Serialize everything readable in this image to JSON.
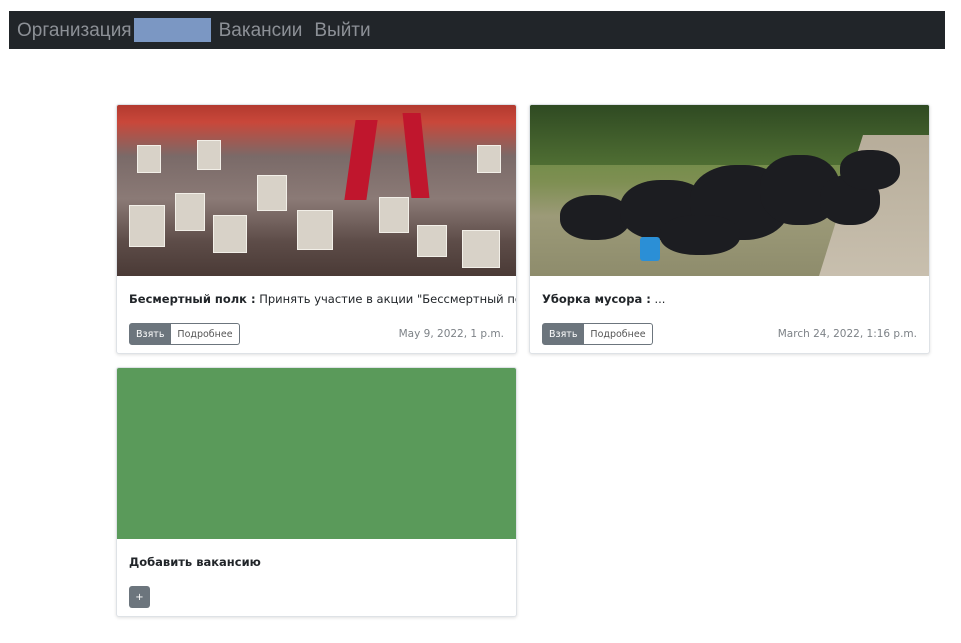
{
  "nav": {
    "brand": "Организация",
    "links": [
      "Вакансии",
      "Выйти"
    ]
  },
  "cards": [
    {
      "title": "Бесмертный полк :",
      "description": "Принять участие в акции \"Бессмертный полк\"",
      "take_label": "Взять",
      "details_label": "Подробнее",
      "date": "May 9, 2022, 1 p.m."
    },
    {
      "title": "Уборка мусора :",
      "description": "...",
      "take_label": "Взять",
      "details_label": "Подробнее",
      "date": "March 24, 2022, 1:16 p.m."
    }
  ],
  "add_card": {
    "title": "Добавить вакансию",
    "button_label": "+"
  },
  "colors": {
    "navbar": "#212529",
    "nav_text": "#8c9096",
    "redaction": "#7b97c3",
    "button_dark": "#6c757d",
    "add_card_image": "#5a9a5a"
  }
}
